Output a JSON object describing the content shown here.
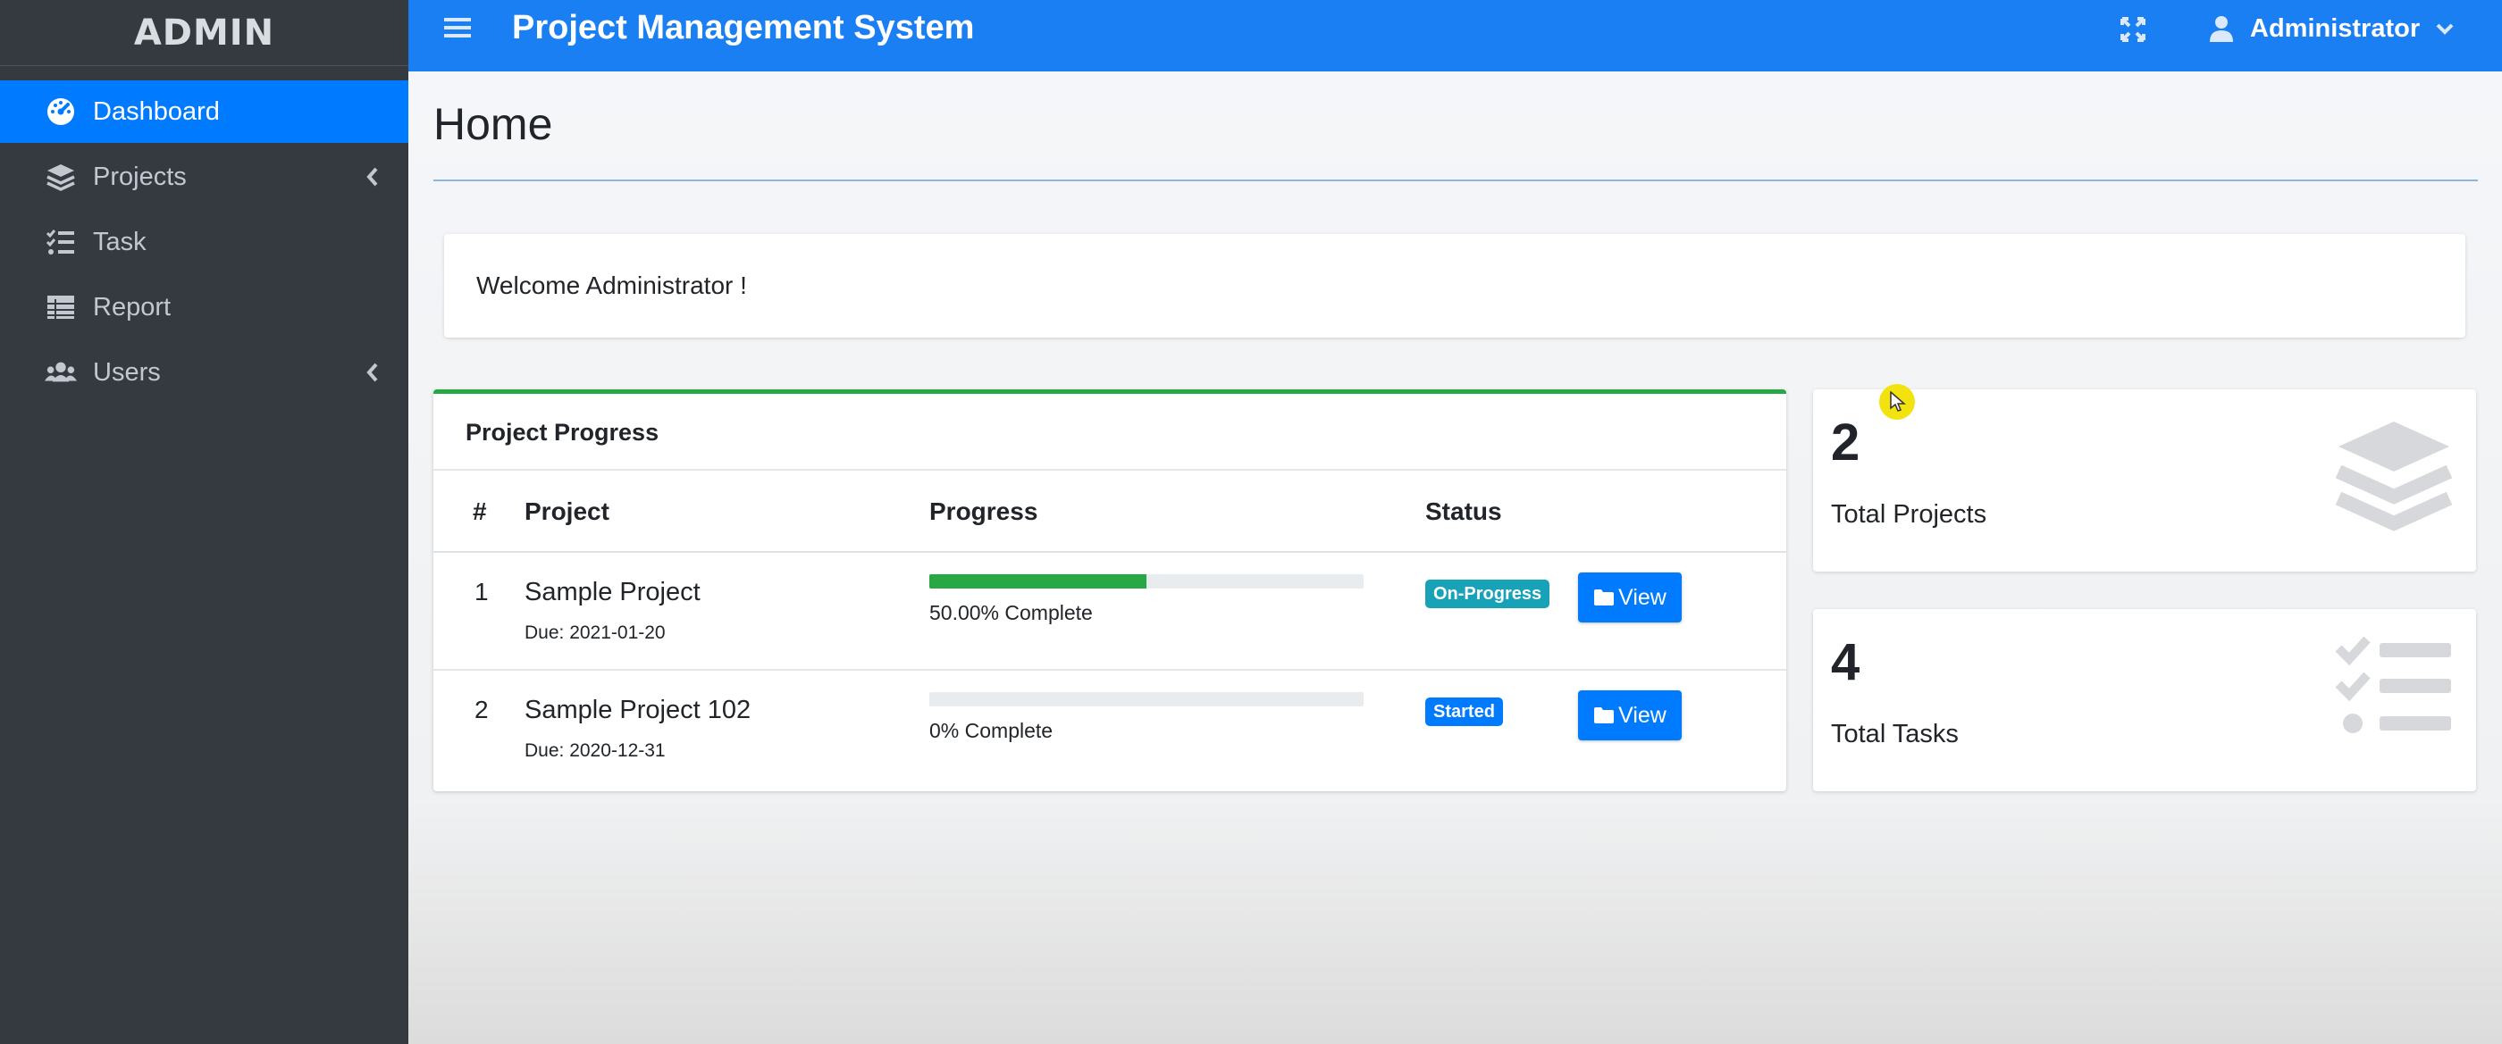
{
  "sidebar": {
    "brand": "ADMIN",
    "items": [
      {
        "label": "Dashboard",
        "icon": "tachometer-icon",
        "active": true
      },
      {
        "label": "Projects",
        "icon": "layers-icon",
        "has_children": true
      },
      {
        "label": "Task",
        "icon": "tasks-icon"
      },
      {
        "label": "Report",
        "icon": "table-icon"
      },
      {
        "label": "Users",
        "icon": "users-icon",
        "has_children": true
      }
    ]
  },
  "topbar": {
    "title": "Project Management System",
    "user_name": "Administrator"
  },
  "main": {
    "page_title": "Home",
    "welcome_text": "Welcome Administrator !",
    "progress_card": {
      "title": "Project Progress",
      "columns": [
        "#",
        "Project",
        "Progress",
        "Status"
      ],
      "rows": [
        {
          "num": "1",
          "name": "Sample Project",
          "due": "Due: 2021-01-20",
          "progress": 50,
          "progress_text": "50.00% Complete",
          "status": "On-Progress",
          "status_color": "#17a2b8",
          "action": "View"
        },
        {
          "num": "2",
          "name": "Sample Project 102",
          "due": "Due: 2020-12-31",
          "progress": 0,
          "progress_text": "0% Complete",
          "status": "Started",
          "status_color": "#007bff",
          "action": "View"
        }
      ]
    },
    "stats": [
      {
        "count": "2",
        "label": "Total Projects",
        "icon": "layers-icon"
      },
      {
        "count": "4",
        "label": "Total Tasks",
        "icon": "tasks-icon"
      }
    ]
  },
  "colors": {
    "sidebar_bg": "#343a40",
    "topbar_bg": "#1a7ff2",
    "active": "#007bff",
    "success": "#28a745",
    "info": "#17a2b8"
  }
}
